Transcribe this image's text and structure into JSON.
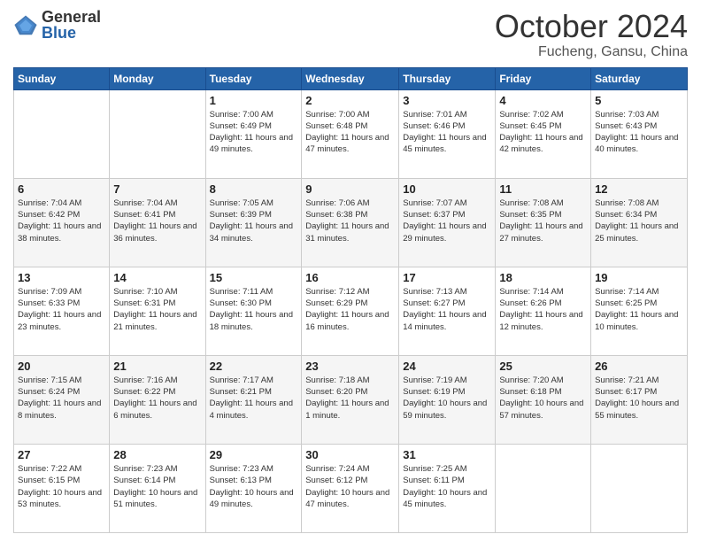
{
  "logo": {
    "general": "General",
    "blue": "Blue"
  },
  "header": {
    "month": "October 2024",
    "location": "Fucheng, Gansu, China"
  },
  "weekdays": [
    "Sunday",
    "Monday",
    "Tuesday",
    "Wednesday",
    "Thursday",
    "Friday",
    "Saturday"
  ],
  "weeks": [
    [
      {
        "day": "",
        "info": ""
      },
      {
        "day": "",
        "info": ""
      },
      {
        "day": "1",
        "info": "Sunrise: 7:00 AM\nSunset: 6:49 PM\nDaylight: 11 hours and 49 minutes."
      },
      {
        "day": "2",
        "info": "Sunrise: 7:00 AM\nSunset: 6:48 PM\nDaylight: 11 hours and 47 minutes."
      },
      {
        "day": "3",
        "info": "Sunrise: 7:01 AM\nSunset: 6:46 PM\nDaylight: 11 hours and 45 minutes."
      },
      {
        "day": "4",
        "info": "Sunrise: 7:02 AM\nSunset: 6:45 PM\nDaylight: 11 hours and 42 minutes."
      },
      {
        "day": "5",
        "info": "Sunrise: 7:03 AM\nSunset: 6:43 PM\nDaylight: 11 hours and 40 minutes."
      }
    ],
    [
      {
        "day": "6",
        "info": "Sunrise: 7:04 AM\nSunset: 6:42 PM\nDaylight: 11 hours and 38 minutes."
      },
      {
        "day": "7",
        "info": "Sunrise: 7:04 AM\nSunset: 6:41 PM\nDaylight: 11 hours and 36 minutes."
      },
      {
        "day": "8",
        "info": "Sunrise: 7:05 AM\nSunset: 6:39 PM\nDaylight: 11 hours and 34 minutes."
      },
      {
        "day": "9",
        "info": "Sunrise: 7:06 AM\nSunset: 6:38 PM\nDaylight: 11 hours and 31 minutes."
      },
      {
        "day": "10",
        "info": "Sunrise: 7:07 AM\nSunset: 6:37 PM\nDaylight: 11 hours and 29 minutes."
      },
      {
        "day": "11",
        "info": "Sunrise: 7:08 AM\nSunset: 6:35 PM\nDaylight: 11 hours and 27 minutes."
      },
      {
        "day": "12",
        "info": "Sunrise: 7:08 AM\nSunset: 6:34 PM\nDaylight: 11 hours and 25 minutes."
      }
    ],
    [
      {
        "day": "13",
        "info": "Sunrise: 7:09 AM\nSunset: 6:33 PM\nDaylight: 11 hours and 23 minutes."
      },
      {
        "day": "14",
        "info": "Sunrise: 7:10 AM\nSunset: 6:31 PM\nDaylight: 11 hours and 21 minutes."
      },
      {
        "day": "15",
        "info": "Sunrise: 7:11 AM\nSunset: 6:30 PM\nDaylight: 11 hours and 18 minutes."
      },
      {
        "day": "16",
        "info": "Sunrise: 7:12 AM\nSunset: 6:29 PM\nDaylight: 11 hours and 16 minutes."
      },
      {
        "day": "17",
        "info": "Sunrise: 7:13 AM\nSunset: 6:27 PM\nDaylight: 11 hours and 14 minutes."
      },
      {
        "day": "18",
        "info": "Sunrise: 7:14 AM\nSunset: 6:26 PM\nDaylight: 11 hours and 12 minutes."
      },
      {
        "day": "19",
        "info": "Sunrise: 7:14 AM\nSunset: 6:25 PM\nDaylight: 11 hours and 10 minutes."
      }
    ],
    [
      {
        "day": "20",
        "info": "Sunrise: 7:15 AM\nSunset: 6:24 PM\nDaylight: 11 hours and 8 minutes."
      },
      {
        "day": "21",
        "info": "Sunrise: 7:16 AM\nSunset: 6:22 PM\nDaylight: 11 hours and 6 minutes."
      },
      {
        "day": "22",
        "info": "Sunrise: 7:17 AM\nSunset: 6:21 PM\nDaylight: 11 hours and 4 minutes."
      },
      {
        "day": "23",
        "info": "Sunrise: 7:18 AM\nSunset: 6:20 PM\nDaylight: 11 hours and 1 minute."
      },
      {
        "day": "24",
        "info": "Sunrise: 7:19 AM\nSunset: 6:19 PM\nDaylight: 10 hours and 59 minutes."
      },
      {
        "day": "25",
        "info": "Sunrise: 7:20 AM\nSunset: 6:18 PM\nDaylight: 10 hours and 57 minutes."
      },
      {
        "day": "26",
        "info": "Sunrise: 7:21 AM\nSunset: 6:17 PM\nDaylight: 10 hours and 55 minutes."
      }
    ],
    [
      {
        "day": "27",
        "info": "Sunrise: 7:22 AM\nSunset: 6:15 PM\nDaylight: 10 hours and 53 minutes."
      },
      {
        "day": "28",
        "info": "Sunrise: 7:23 AM\nSunset: 6:14 PM\nDaylight: 10 hours and 51 minutes."
      },
      {
        "day": "29",
        "info": "Sunrise: 7:23 AM\nSunset: 6:13 PM\nDaylight: 10 hours and 49 minutes."
      },
      {
        "day": "30",
        "info": "Sunrise: 7:24 AM\nSunset: 6:12 PM\nDaylight: 10 hours and 47 minutes."
      },
      {
        "day": "31",
        "info": "Sunrise: 7:25 AM\nSunset: 6:11 PM\nDaylight: 10 hours and 45 minutes."
      },
      {
        "day": "",
        "info": ""
      },
      {
        "day": "",
        "info": ""
      }
    ]
  ]
}
